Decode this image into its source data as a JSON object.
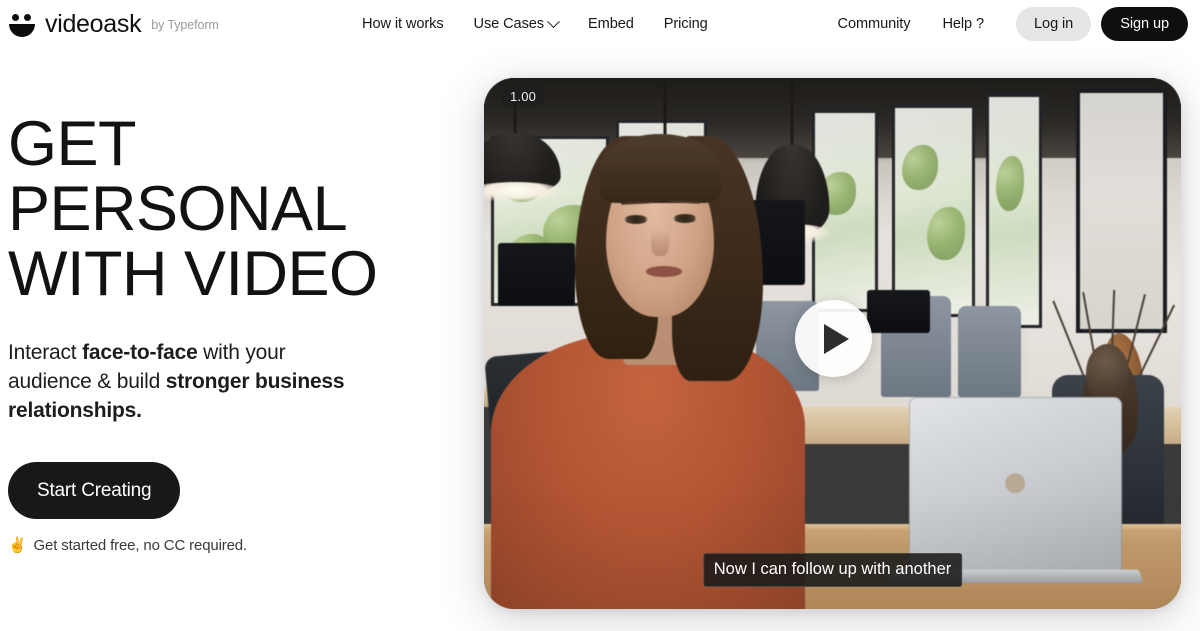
{
  "header": {
    "brand": {
      "name": "videoask",
      "byline": "by Typeform",
      "icon": "smiley-face-logo-icon"
    },
    "nav": [
      {
        "label": "How it works",
        "has_dropdown": false
      },
      {
        "label": "Use Cases",
        "has_dropdown": true
      },
      {
        "label": "Embed",
        "has_dropdown": false
      },
      {
        "label": "Pricing",
        "has_dropdown": false
      }
    ],
    "nav_right": [
      {
        "label": "Community"
      },
      {
        "label": "Help ?"
      }
    ],
    "login_label": "Log in",
    "signup_label": "Sign up"
  },
  "hero": {
    "headline_line1": "GET",
    "headline_line2": "PERSONAL",
    "headline_line3": "WITH VIDEO",
    "subhead_part1": "Interact ",
    "subhead_bold1": "face-to-face",
    "subhead_part2": " with your audience & build ",
    "subhead_bold2": "stronger business relationships.",
    "cta_label": "Start Creating",
    "note_emoji": "✌️",
    "note_text": "Get started free, no CC required."
  },
  "video": {
    "timer": "1.00",
    "caption": "Now I can follow up with another",
    "play_icon": "play-triangle-icon"
  },
  "colors": {
    "accent_dark": "#0f0f10",
    "login_pill": "#e5e5e5",
    "text": "#17181a",
    "muted": "#9b9b9b",
    "sweater": "#b45634"
  }
}
